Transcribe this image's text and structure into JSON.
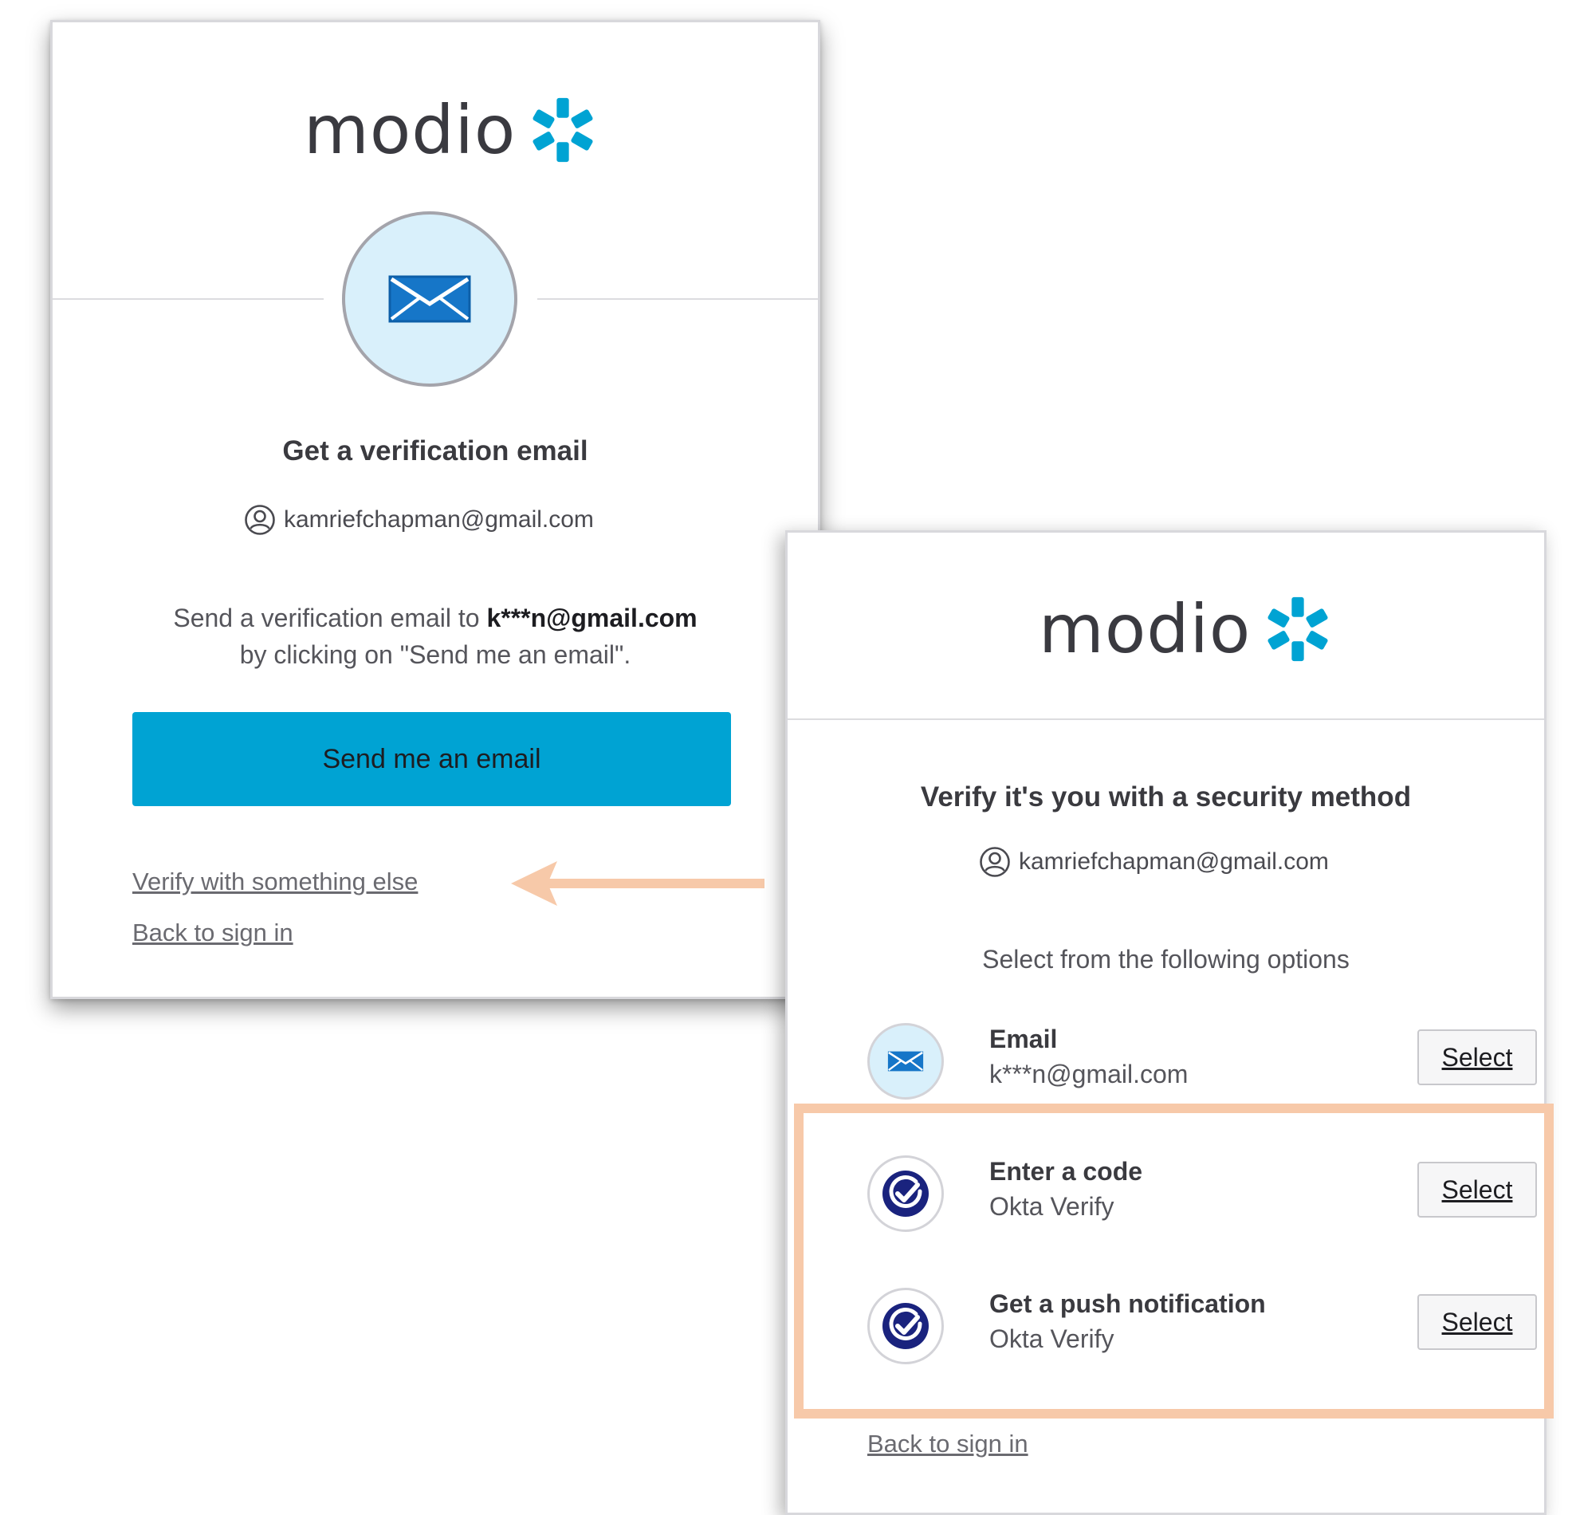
{
  "brand": {
    "name": "modio",
    "accent_color": "#00a3d3",
    "highlight_color": "#f7c9a9"
  },
  "email_panel": {
    "icon": "envelope-icon",
    "title": "Get a verification email",
    "user_email": "kamriefchapman@gmail.com",
    "instruction_prefix": "Send a verification email to",
    "masked_email": "k***n@gmail.com",
    "instruction_suffix": "by clicking on \"Send me an email\".",
    "send_button": "Send me an email",
    "verify_else_link": "Verify with something else",
    "back_link": "Back to sign in"
  },
  "methods_panel": {
    "title": "Verify it's you with a security method",
    "user_email": "kamriefchapman@gmail.com",
    "prompt": "Select from the following options",
    "options": [
      {
        "title": "Email",
        "subtitle": "k***n@gmail.com",
        "button": "Select",
        "icon": "envelope-icon"
      },
      {
        "title": "Enter a code",
        "subtitle": "Okta Verify",
        "button": "Select",
        "icon": "okta-verify-icon"
      },
      {
        "title": "Get a push notification",
        "subtitle": "Okta Verify",
        "button": "Select",
        "icon": "okta-verify-icon"
      }
    ],
    "back_link": "Back to sign in"
  }
}
